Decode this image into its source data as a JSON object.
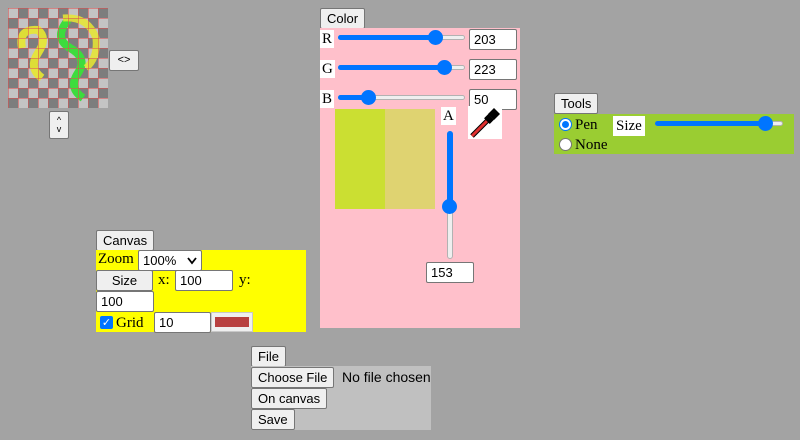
{
  "preview": {
    "expand_button": "<>",
    "expand_vertical_button": "^\nv"
  },
  "color": {
    "title": "Color",
    "r_label": "R",
    "r_value": "203",
    "r_level": 0.8,
    "g_label": "G",
    "g_value": "223",
    "g_level": 0.875,
    "b_label": "B",
    "b_value": "50",
    "b_level": 0.2,
    "a_label": "A",
    "a_value": "153",
    "a_level": 0.6,
    "current_swatch": "#cbdf32",
    "alpha_swatch": "#dfd371",
    "panel_bg": "#ffc0cb"
  },
  "tools": {
    "title": "Tools",
    "pen_label": "Pen",
    "none_label": "None",
    "size_label": "Size",
    "size_level": 0.9,
    "panel_bg": "#9acd32"
  },
  "canvas": {
    "title": "Canvas",
    "zoom_label": "Zoom",
    "zoom_value": "100%",
    "size_button": "Size",
    "x_label": "x:",
    "x_value": "100",
    "y_label": "y:",
    "y_value": "100",
    "grid_label": "Grid",
    "grid_value": "10",
    "grid_color": "#b84040",
    "panel_bg": "#ffff00"
  },
  "file": {
    "title": "File",
    "choose_button": "Choose File",
    "no_file_text": "No file chosen",
    "on_canvas_button": "On canvas",
    "save_button": "Save",
    "panel_bg": "#c0c0c0"
  }
}
